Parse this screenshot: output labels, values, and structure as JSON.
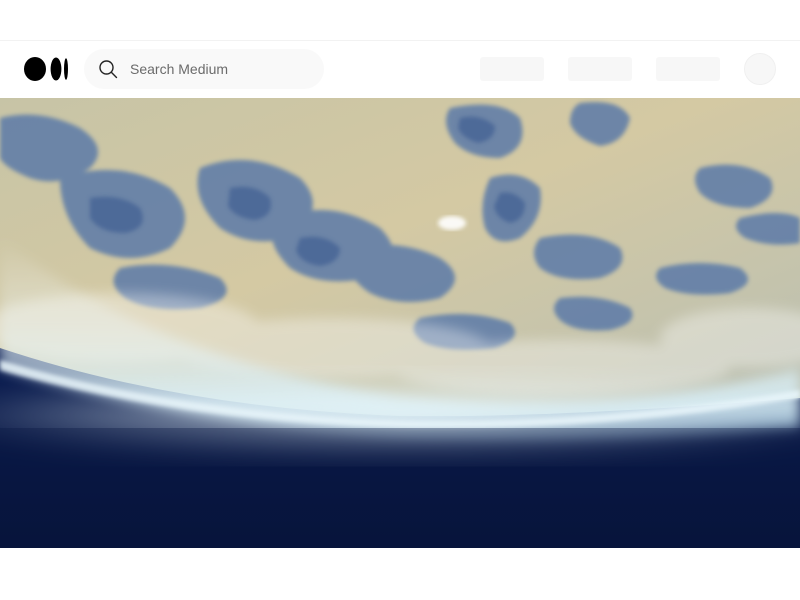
{
  "search": {
    "placeholder": "Search Medium"
  },
  "icons": {
    "logo": "medium-logo-icon",
    "search": "search-icon"
  },
  "colors": {
    "text": "#242424",
    "placeholder_text": "#6b6b6b",
    "search_background": "#f9f9f9",
    "skeleton": "#f7f7f7",
    "space_dark": "#0b1a45",
    "atmosphere_glow": "#cfe9f3"
  },
  "hero": {
    "image": "earth-from-space-photo"
  }
}
